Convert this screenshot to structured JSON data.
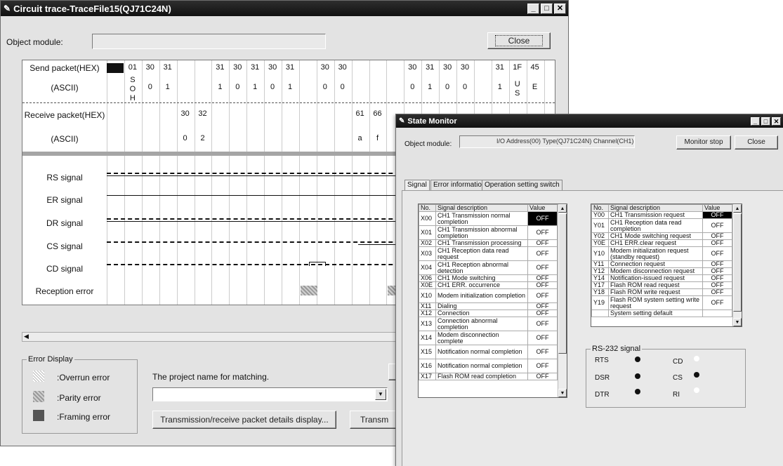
{
  "trace_window": {
    "title": "Circuit trace-TraceFile15(QJ71C24N)",
    "object_module_label": "Object module:",
    "close_label": "Close",
    "rows": {
      "send_hex": "Send packet(HEX)",
      "send_ascii": "(ASCII)",
      "recv_hex": "Receive packet(HEX)",
      "recv_ascii": "(ASCII)",
      "rs": "RS signal",
      "er": "ER signal",
      "dr": "DR signal",
      "cs": "CS signal",
      "cd": "CD signal",
      "rx_err": "Reception error"
    },
    "send_hex": [
      "",
      "01",
      "30",
      "31",
      "",
      "",
      "31",
      "30",
      "31",
      "30",
      "31",
      "",
      "30",
      "30",
      "",
      "",
      "",
      "30",
      "31",
      "30",
      "30",
      "",
      "31",
      "1F",
      "45"
    ],
    "send_ascii": [
      "",
      "S\nO\nH",
      "0",
      "1",
      "",
      "",
      "1",
      "0",
      "1",
      "0",
      "1",
      "",
      "0",
      "0",
      "",
      "",
      "",
      "0",
      "1",
      "0",
      "0",
      "",
      "1",
      "U\nS",
      "E"
    ],
    "recv_hex": [
      "",
      "",
      "",
      "",
      "30",
      "32",
      "",
      "",
      "",
      "",
      "",
      "",
      "",
      "",
      "61",
      "66"
    ],
    "recv_ascii": [
      "",
      "",
      "",
      "",
      "0",
      "2",
      "",
      "",
      "",
      "",
      "",
      "",
      "",
      "",
      "a",
      "f"
    ],
    "error_display": {
      "title": "Error Display",
      "overrun": ":Overrun error",
      "parity": ":Parity error",
      "framing": ":Framing error"
    },
    "project_label": "The project name for matching.",
    "details_btn": "Transmission/receive packet details display...",
    "trans_btn": "Transm"
  },
  "state_monitor": {
    "title": "State Monitor",
    "object_module_label": "Object module:",
    "object_module_value": "I/O Address(00) Type(QJ71C24N) Channel(CH1)",
    "monitor_stop_label": "Monitor stop",
    "close_label": "Close",
    "tabs": [
      "Signal",
      "Error information",
      "Operation setting switch"
    ],
    "cols": {
      "no": "No.",
      "desc": "Signal description",
      "value": "Value"
    },
    "x_signals": [
      {
        "no": "X00",
        "desc": "CH1 Transmission normal completion",
        "value": "OFF"
      },
      {
        "no": "X01",
        "desc": "CH1 Transmission abnormal completion",
        "value": "OFF"
      },
      {
        "no": "X02",
        "desc": "CH1 Transmission processing",
        "value": "OFF"
      },
      {
        "no": "X03",
        "desc": "CH1 Reception data read request",
        "value": "OFF"
      },
      {
        "no": "X04",
        "desc": "CH1 Reception abnormal detection",
        "value": "OFF"
      },
      {
        "no": "X06",
        "desc": "CH1 Mode switching",
        "value": "OFF"
      },
      {
        "no": "X0E",
        "desc": "CH1 ERR. occurrence",
        "value": "OFF"
      },
      {
        "no": "X10",
        "desc": "Modem initialization completion",
        "value": "OFF"
      },
      {
        "no": "X11",
        "desc": "Dialing",
        "value": "OFF"
      },
      {
        "no": "X12",
        "desc": "Connection",
        "value": "OFF"
      },
      {
        "no": "X13",
        "desc": "Connection abnormal completion",
        "value": "OFF"
      },
      {
        "no": "X14",
        "desc": "Modem disconnection complete",
        "value": "OFF"
      },
      {
        "no": "X15",
        "desc": "Notification normal completion",
        "value": "OFF"
      },
      {
        "no": "X16",
        "desc": "Notification normal completion",
        "value": "OFF"
      },
      {
        "no": "X17",
        "desc": "Flash ROM read completion",
        "value": "OFF"
      }
    ],
    "y_signals": [
      {
        "no": "Y00",
        "desc": "CH1 Transmission request",
        "value": "OFF"
      },
      {
        "no": "Y01",
        "desc": "CH1 Reception data read completion",
        "value": "OFF"
      },
      {
        "no": "Y02",
        "desc": "CH1 Mode switching request",
        "value": "OFF"
      },
      {
        "no": "Y0E",
        "desc": "CH1 ERR.clear request",
        "value": "OFF"
      },
      {
        "no": "Y10",
        "desc": "Modem initialization request (standby request)",
        "value": "OFF"
      },
      {
        "no": "Y11",
        "desc": "Connection request",
        "value": "OFF"
      },
      {
        "no": "Y12",
        "desc": "Modem disconnection request",
        "value": "OFF"
      },
      {
        "no": "Y14",
        "desc": "Notification-issued request",
        "value": "OFF"
      },
      {
        "no": "Y17",
        "desc": "Flash ROM read request",
        "value": "OFF"
      },
      {
        "no": "Y18",
        "desc": "Flash ROM write request",
        "value": "OFF"
      },
      {
        "no": "Y19",
        "desc": "Flash ROM system setting write request",
        "value": "OFF"
      },
      {
        "no": "",
        "desc": "System setting default",
        "value": ""
      }
    ],
    "rs232": {
      "title": "RS-232 signal",
      "rts": "RTS",
      "dsr": "DSR",
      "dtr": "DTR",
      "cd": "CD",
      "cs": "CS",
      "ri": "RI",
      "states": {
        "rts": "on",
        "dsr": "on",
        "dtr": "on",
        "cd": "off",
        "cs": "on",
        "ri": "off"
      }
    }
  }
}
